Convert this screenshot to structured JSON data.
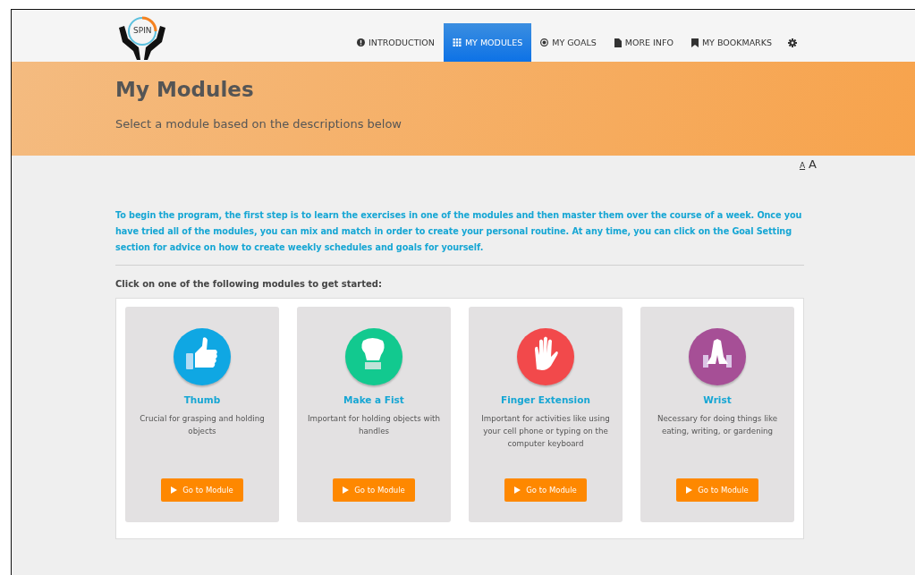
{
  "nav": {
    "items": [
      {
        "label": "INTRODUCTION",
        "selected": false
      },
      {
        "label": "MY MODULES",
        "selected": true
      },
      {
        "label": "MY GOALS",
        "selected": false
      },
      {
        "label": "MORE INFO",
        "selected": false
      },
      {
        "label": "MY BOOKMARKS",
        "selected": false
      }
    ],
    "logo_text": "SPIN"
  },
  "banner": {
    "title": "My Modules",
    "subtitle": "Select a module based on the descriptions below"
  },
  "font_size": [
    {
      "label": "A",
      "selected": true
    },
    {
      "label": "A",
      "selected": false
    }
  ],
  "intro": "To begin the program, the first step is to learn the exercises in one of the modules and then master them over the course of a week. Once you have tried all of the modules, you can mix and match in order to create your personal routine. At any time, you can click on the Goal Setting section for advice on how to create weekly schedules and goals for yourself.",
  "prompt": "Click on one of the following modules to get started:",
  "modules": [
    {
      "kind": "thumb",
      "color": "#0fa7e3",
      "title": "Thumb",
      "description": "Crucial for grasping and holding objects",
      "button": "Go to Module"
    },
    {
      "kind": "fist",
      "color": "#12c98f",
      "title": "Make a Fist",
      "description": "Important for holding objects with handles",
      "button": "Go to Module"
    },
    {
      "kind": "hand",
      "color": "#f2494b",
      "title": "Finger Extension",
      "description": "Important for activities like using your cell phone or typing on the computer keyboard",
      "button": "Go to Module"
    },
    {
      "kind": "wrist",
      "color": "#a64f96",
      "title": "Wrist",
      "description": "Necessary for doing things like eating, writing, or gardening",
      "button": "Go to Module"
    }
  ]
}
